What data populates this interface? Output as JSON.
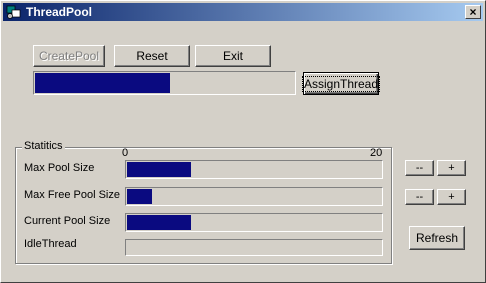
{
  "window": {
    "title": "ThreadPool",
    "close_glyph": "×"
  },
  "toolbar": {
    "create_pool_label": "CreatePool",
    "reset_label": "Reset",
    "exit_label": "Exit",
    "assign_thread_label": "AssignThread"
  },
  "main_progress": {
    "value": 0.52
  },
  "statistics": {
    "group_label": "Statitics",
    "scale_min_label": "0",
    "scale_max_label": "20",
    "rows": [
      {
        "label": "Max Pool Size",
        "value": 5
      },
      {
        "label": "Max Free Pool Size",
        "value": 2
      },
      {
        "label": "Current Pool Size",
        "value": 5
      },
      {
        "label": "IdleThread",
        "value": 0
      }
    ],
    "scale_max": 20
  },
  "controls": {
    "decrement_label": "--",
    "increment_label": "+",
    "refresh_label": "Refresh"
  },
  "colors": {
    "title_start": "#0a246a",
    "title_end": "#a6caf0",
    "bar_fill": "#0a0a80",
    "face": "#d4d0c8"
  }
}
